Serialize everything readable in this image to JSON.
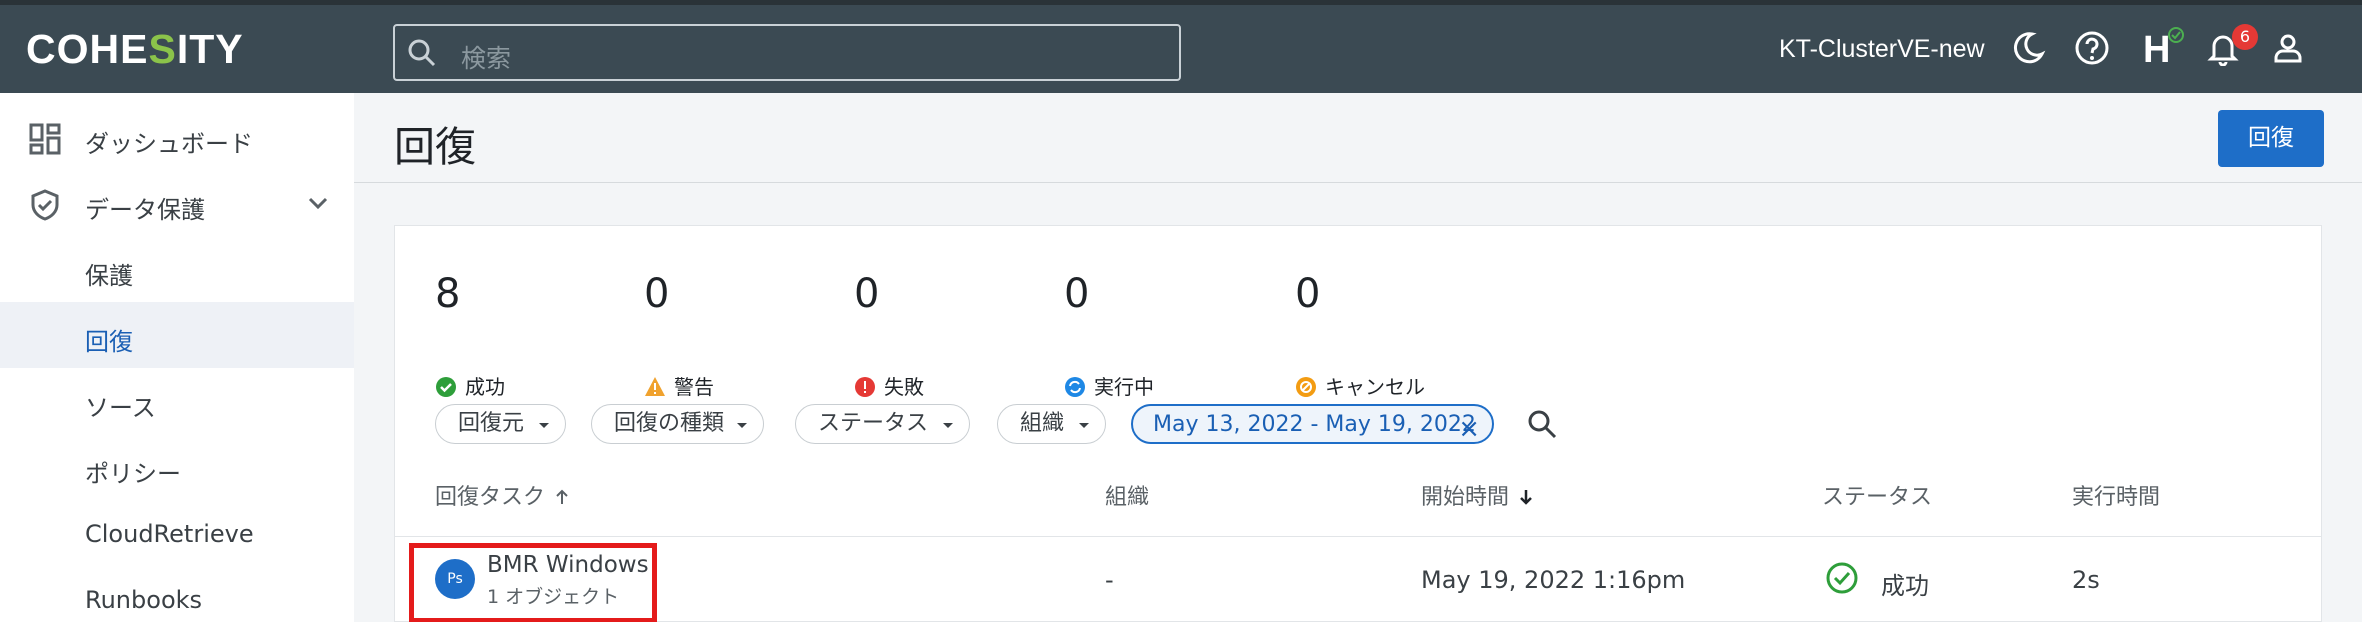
{
  "brand": {
    "logo_pre": "COHE",
    "logo_s": "S",
    "logo_post": "ITY"
  },
  "search": {
    "placeholder": "検索"
  },
  "header": {
    "cluster_name": "KT-ClusterVE-new",
    "helios_letter": "H",
    "notification_count": "6"
  },
  "sidebar": {
    "items": [
      {
        "label": "ダッシュボード",
        "icon": "dashboard-icon"
      },
      {
        "label": "データ保護",
        "icon": "shield-icon",
        "expandable": true
      },
      {
        "label": "保護"
      },
      {
        "label": "回復",
        "active": true
      },
      {
        "label": "ソース"
      },
      {
        "label": "ポリシー"
      },
      {
        "label": "CloudRetrieve"
      },
      {
        "label": "Runbooks"
      }
    ]
  },
  "page": {
    "title": "回復",
    "primary_button": "回復"
  },
  "stats": [
    {
      "value": "8",
      "label": "成功",
      "color": "#2e9e3a"
    },
    {
      "value": "0",
      "label": "警告",
      "color": "#f0a22e"
    },
    {
      "value": "0",
      "label": "失敗",
      "color": "#e53935"
    },
    {
      "value": "0",
      "label": "実行中",
      "color": "#1e88e5"
    },
    {
      "value": "0",
      "label": "キャンセル",
      "color": "#f39c12"
    }
  ],
  "filters": {
    "chips": [
      "回復元",
      "回復の種類",
      "ステータス",
      "組織"
    ],
    "date_range": "May 13, 2022 - May 19, 2022"
  },
  "table": {
    "columns": [
      "回復タスク",
      "組織",
      "開始時間",
      "ステータス",
      "実行時間"
    ],
    "rows": [
      {
        "avatar": "Ps",
        "task": "BMR Windows",
        "objects": "1 オブジェクト",
        "org": "-",
        "start": "May 19, 2022 1:16pm",
        "status": "成功",
        "duration": "2s"
      }
    ]
  },
  "colors": {
    "topbar": "#3b4a53",
    "accent": "#1e6ec8",
    "highlight": "#e41b1b",
    "success": "#2e9e3a"
  }
}
